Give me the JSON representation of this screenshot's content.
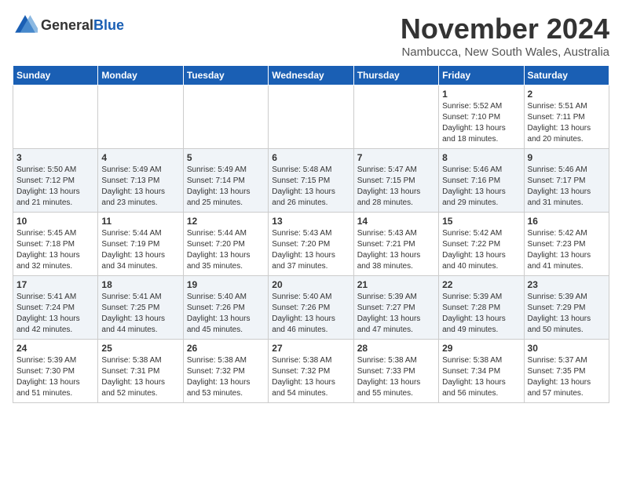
{
  "header": {
    "logo_general": "General",
    "logo_blue": "Blue",
    "month_year": "November 2024",
    "location": "Nambucca, New South Wales, Australia"
  },
  "days_of_week": [
    "Sunday",
    "Monday",
    "Tuesday",
    "Wednesday",
    "Thursday",
    "Friday",
    "Saturday"
  ],
  "weeks": [
    [
      {
        "day": "",
        "info": ""
      },
      {
        "day": "",
        "info": ""
      },
      {
        "day": "",
        "info": ""
      },
      {
        "day": "",
        "info": ""
      },
      {
        "day": "",
        "info": ""
      },
      {
        "day": "1",
        "info": "Sunrise: 5:52 AM\nSunset: 7:10 PM\nDaylight: 13 hours\nand 18 minutes."
      },
      {
        "day": "2",
        "info": "Sunrise: 5:51 AM\nSunset: 7:11 PM\nDaylight: 13 hours\nand 20 minutes."
      }
    ],
    [
      {
        "day": "3",
        "info": "Sunrise: 5:50 AM\nSunset: 7:12 PM\nDaylight: 13 hours\nand 21 minutes."
      },
      {
        "day": "4",
        "info": "Sunrise: 5:49 AM\nSunset: 7:13 PM\nDaylight: 13 hours\nand 23 minutes."
      },
      {
        "day": "5",
        "info": "Sunrise: 5:49 AM\nSunset: 7:14 PM\nDaylight: 13 hours\nand 25 minutes."
      },
      {
        "day": "6",
        "info": "Sunrise: 5:48 AM\nSunset: 7:15 PM\nDaylight: 13 hours\nand 26 minutes."
      },
      {
        "day": "7",
        "info": "Sunrise: 5:47 AM\nSunset: 7:15 PM\nDaylight: 13 hours\nand 28 minutes."
      },
      {
        "day": "8",
        "info": "Sunrise: 5:46 AM\nSunset: 7:16 PM\nDaylight: 13 hours\nand 29 minutes."
      },
      {
        "day": "9",
        "info": "Sunrise: 5:46 AM\nSunset: 7:17 PM\nDaylight: 13 hours\nand 31 minutes."
      }
    ],
    [
      {
        "day": "10",
        "info": "Sunrise: 5:45 AM\nSunset: 7:18 PM\nDaylight: 13 hours\nand 32 minutes."
      },
      {
        "day": "11",
        "info": "Sunrise: 5:44 AM\nSunset: 7:19 PM\nDaylight: 13 hours\nand 34 minutes."
      },
      {
        "day": "12",
        "info": "Sunrise: 5:44 AM\nSunset: 7:20 PM\nDaylight: 13 hours\nand 35 minutes."
      },
      {
        "day": "13",
        "info": "Sunrise: 5:43 AM\nSunset: 7:20 PM\nDaylight: 13 hours\nand 37 minutes."
      },
      {
        "day": "14",
        "info": "Sunrise: 5:43 AM\nSunset: 7:21 PM\nDaylight: 13 hours\nand 38 minutes."
      },
      {
        "day": "15",
        "info": "Sunrise: 5:42 AM\nSunset: 7:22 PM\nDaylight: 13 hours\nand 40 minutes."
      },
      {
        "day": "16",
        "info": "Sunrise: 5:42 AM\nSunset: 7:23 PM\nDaylight: 13 hours\nand 41 minutes."
      }
    ],
    [
      {
        "day": "17",
        "info": "Sunrise: 5:41 AM\nSunset: 7:24 PM\nDaylight: 13 hours\nand 42 minutes."
      },
      {
        "day": "18",
        "info": "Sunrise: 5:41 AM\nSunset: 7:25 PM\nDaylight: 13 hours\nand 44 minutes."
      },
      {
        "day": "19",
        "info": "Sunrise: 5:40 AM\nSunset: 7:26 PM\nDaylight: 13 hours\nand 45 minutes."
      },
      {
        "day": "20",
        "info": "Sunrise: 5:40 AM\nSunset: 7:26 PM\nDaylight: 13 hours\nand 46 minutes."
      },
      {
        "day": "21",
        "info": "Sunrise: 5:39 AM\nSunset: 7:27 PM\nDaylight: 13 hours\nand 47 minutes."
      },
      {
        "day": "22",
        "info": "Sunrise: 5:39 AM\nSunset: 7:28 PM\nDaylight: 13 hours\nand 49 minutes."
      },
      {
        "day": "23",
        "info": "Sunrise: 5:39 AM\nSunset: 7:29 PM\nDaylight: 13 hours\nand 50 minutes."
      }
    ],
    [
      {
        "day": "24",
        "info": "Sunrise: 5:39 AM\nSunset: 7:30 PM\nDaylight: 13 hours\nand 51 minutes."
      },
      {
        "day": "25",
        "info": "Sunrise: 5:38 AM\nSunset: 7:31 PM\nDaylight: 13 hours\nand 52 minutes."
      },
      {
        "day": "26",
        "info": "Sunrise: 5:38 AM\nSunset: 7:32 PM\nDaylight: 13 hours\nand 53 minutes."
      },
      {
        "day": "27",
        "info": "Sunrise: 5:38 AM\nSunset: 7:32 PM\nDaylight: 13 hours\nand 54 minutes."
      },
      {
        "day": "28",
        "info": "Sunrise: 5:38 AM\nSunset: 7:33 PM\nDaylight: 13 hours\nand 55 minutes."
      },
      {
        "day": "29",
        "info": "Sunrise: 5:38 AM\nSunset: 7:34 PM\nDaylight: 13 hours\nand 56 minutes."
      },
      {
        "day": "30",
        "info": "Sunrise: 5:37 AM\nSunset: 7:35 PM\nDaylight: 13 hours\nand 57 minutes."
      }
    ]
  ]
}
